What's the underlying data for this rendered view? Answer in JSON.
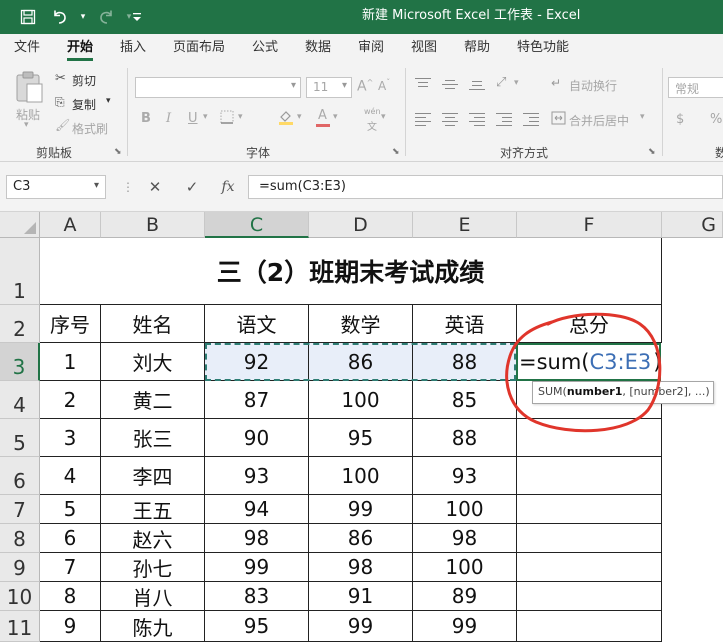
{
  "window": {
    "title": "新建 Microsoft Excel 工作表 - Excel"
  },
  "qat": {
    "save_icon": "save-icon",
    "undo_icon": "undo-icon",
    "redo_icon": "redo-icon",
    "customize_icon": "customize-qat-icon"
  },
  "tabs": [
    "文件",
    "开始",
    "插入",
    "页面布局",
    "公式",
    "数据",
    "审阅",
    "视图",
    "帮助",
    "特色功能"
  ],
  "ribbon": {
    "clipboard": {
      "paste": "粘贴",
      "cut": "剪切",
      "copy": "复制",
      "format_painter": "格式刷",
      "group_label": "剪贴板"
    },
    "font": {
      "font_size": "11",
      "bold": "B",
      "italic": "I",
      "underline": "U",
      "font_color": "A",
      "phonetic": "wén",
      "group_label": "字体"
    },
    "alignment": {
      "wrap_text": "自动换行",
      "merge_center": "合并后居中",
      "group_label": "对齐方式"
    },
    "number": {
      "format": "常规",
      "percent": "%",
      "group_label": "数"
    }
  },
  "formula_bar": {
    "name_box": "C3",
    "cancel": "✕",
    "enter": "✓",
    "fx": "fx",
    "formula": "=sum(C3:E3)"
  },
  "sheet": {
    "columns": [
      "A",
      "B",
      "C",
      "D",
      "E",
      "F",
      "G"
    ],
    "rows": [
      "1",
      "2",
      "3",
      "4",
      "5",
      "6",
      "7",
      "8",
      "9",
      "10",
      "11"
    ],
    "title": "三（2）班期末考试成绩",
    "headers": [
      "序号",
      "姓名",
      "语文",
      "数学",
      "英语",
      "总分"
    ],
    "data": [
      [
        "1",
        "刘大",
        "92",
        "86",
        "88"
      ],
      [
        "2",
        "黄二",
        "87",
        "100",
        "85"
      ],
      [
        "3",
        "张三",
        "90",
        "95",
        "88"
      ],
      [
        "4",
        "李四",
        "93",
        "100",
        "93"
      ],
      [
        "5",
        "王五",
        "94",
        "99",
        "100"
      ],
      [
        "6",
        "赵六",
        "98",
        "86",
        "98"
      ],
      [
        "7",
        "孙七",
        "99",
        "98",
        "100"
      ],
      [
        "8",
        "肖八",
        "83",
        "91",
        "89"
      ],
      [
        "9",
        "陈九",
        "95",
        "99",
        "99"
      ]
    ],
    "editing": {
      "prefix": "=sum(",
      "range": "C3:E3",
      "suffix": ")"
    },
    "tooltip": {
      "fn": "SUM(",
      "arg1": "number1",
      "rest": ", [number2], ...)"
    },
    "annotation_color": "#e0352b",
    "accent_color": "#217346"
  }
}
